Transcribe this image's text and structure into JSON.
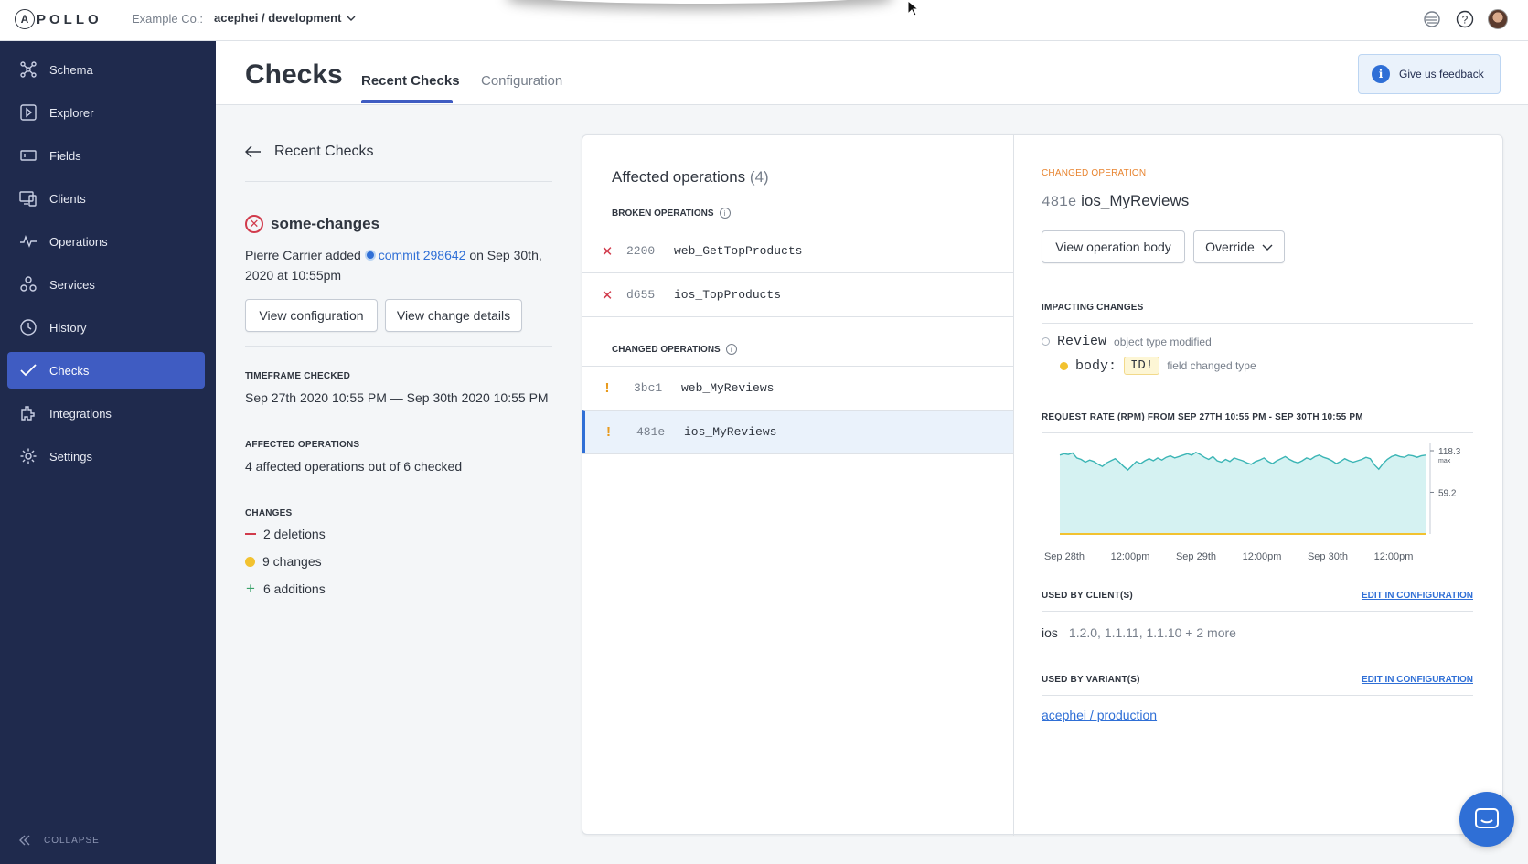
{
  "topbar": {
    "logo": "APOLLO",
    "org_label": "Example Co.:",
    "graph_variant": "acephei / development"
  },
  "sidebar": {
    "items": [
      {
        "label": "Schema",
        "icon": "schema-icon"
      },
      {
        "label": "Explorer",
        "icon": "explorer-icon"
      },
      {
        "label": "Fields",
        "icon": "fields-icon"
      },
      {
        "label": "Clients",
        "icon": "clients-icon"
      },
      {
        "label": "Operations",
        "icon": "operations-icon"
      },
      {
        "label": "Services",
        "icon": "services-icon"
      },
      {
        "label": "History",
        "icon": "history-icon"
      },
      {
        "label": "Checks",
        "icon": "checks-icon",
        "active": true
      },
      {
        "label": "Integrations",
        "icon": "integrations-icon"
      },
      {
        "label": "Settings",
        "icon": "settings-icon"
      }
    ],
    "collapse_label": "COLLAPSE"
  },
  "header": {
    "title": "Checks",
    "tabs": [
      {
        "label": "Recent Checks",
        "active": true
      },
      {
        "label": "Configuration",
        "active": false
      }
    ],
    "feedback_label": "Give us feedback"
  },
  "detail": {
    "back_label": "Recent Checks",
    "check_name": "some-changes",
    "author_prefix": "Pierre Carrier added",
    "commit_link": "commit 298642",
    "commit_suffix": "on Sep 30th, 2020 at 10:55pm",
    "view_configuration": "View configuration",
    "view_change_details": "View change details",
    "timeframe_label": "TIMEFRAME CHECKED",
    "timeframe_value": "Sep 27th 2020 10:55 PM — Sep 30th 2020 10:55 PM",
    "affected_label": "AFFECTED OPERATIONS",
    "affected_value": "4 affected operations out of 6 checked",
    "changes_label": "CHANGES",
    "deletions": "2 deletions",
    "changes": "9 changes",
    "additions": "6 additions"
  },
  "operations": {
    "title": "Affected operations",
    "count": "(4)",
    "broken_label": "BROKEN OPERATIONS",
    "broken": [
      {
        "hash": "2200",
        "name": "web_GetTopProducts"
      },
      {
        "hash": "d655",
        "name": "ios_TopProducts"
      }
    ],
    "changed_label": "CHANGED OPERATIONS",
    "changed": [
      {
        "hash": "3bc1",
        "name": "web_MyReviews"
      },
      {
        "hash": "481e",
        "name": "ios_MyReviews"
      }
    ]
  },
  "right": {
    "changed_label": "CHANGED OPERATION",
    "op_hash": "481e",
    "op_name": "ios_MyReviews",
    "view_body": "View operation body",
    "override": "Override",
    "impacting_label": "IMPACTING CHANGES",
    "type_name": "Review",
    "type_change": "object type modified",
    "field_name": "body:",
    "field_type": "ID!",
    "field_change": "field changed type",
    "request_rate_label": "REQUEST RATE (RPM) FROM SEP 27TH 10:55 PM - SEP 30TH 10:55 PM",
    "clients_label": "USED BY CLIENT(S)",
    "clients_edit": "EDIT IN CONFIGURATION",
    "client_name": "ios",
    "client_versions": "1.2.0, 1.1.11, 1.1.10 + 2 more",
    "variants_label": "USED BY VARIANT(S)",
    "variants_edit": "EDIT IN CONFIGURATION",
    "variant_link": "acephei / production"
  },
  "chart_data": {
    "type": "area",
    "title": "REQUEST RATE (RPM) FROM SEP 27TH 10:55 PM - SEP 30TH 10:55 PM",
    "x_ticks": [
      "Sep 28th",
      "12:00pm",
      "Sep 29th",
      "12:00pm",
      "Sep 30th",
      "12:00pm"
    ],
    "y_ticks": [
      {
        "value": 118.3,
        "label": "118.3",
        "sublabel": "max"
      },
      {
        "value": 59.2,
        "label": "59.2"
      }
    ],
    "ylim": [
      0,
      130
    ],
    "series": [
      {
        "values": [
          112,
          114,
          113,
          115,
          108,
          106,
          102,
          105,
          103,
          99,
          96,
          101,
          104,
          107,
          102,
          96,
          91,
          97,
          103,
          100,
          104,
          107,
          104,
          108,
          105,
          109,
          111,
          108,
          110,
          112,
          114,
          112,
          116,
          113,
          109,
          106,
          110,
          104,
          102,
          106,
          103,
          108,
          106,
          104,
          101,
          99,
          103,
          105,
          108,
          103,
          100,
          104,
          107,
          110,
          106,
          103,
          101,
          104,
          108,
          106,
          110,
          112,
          109,
          107,
          104,
          100,
          103,
          107,
          104,
          102,
          104,
          106,
          109,
          107,
          98,
          92,
          100,
          106,
          110,
          112,
          110,
          109,
          112,
          111,
          109,
          111,
          112
        ]
      }
    ],
    "colors": {
      "fill": "#d5f2f2",
      "line": "#3bb5b5",
      "baseline": "#f2c230"
    }
  }
}
